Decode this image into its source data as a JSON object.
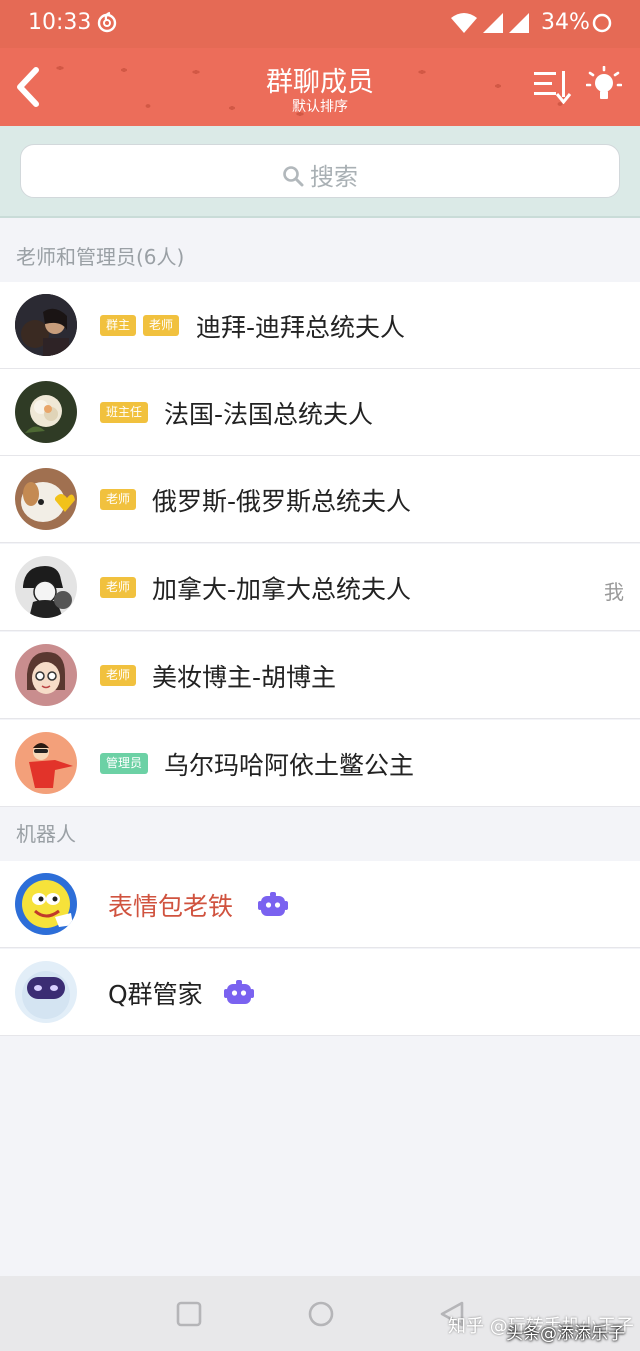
{
  "status_bar": {
    "time": "10:33",
    "battery": "34%",
    "icons": [
      "netease-music-icon",
      "wifi-icon",
      "signal-icon",
      "signal-icon",
      "battery-ring-icon"
    ]
  },
  "header": {
    "title": "群聊成员",
    "subtitle": "默认排序",
    "back_icon": "chevron-left-icon",
    "sort_icon": "sort-list-icon",
    "bulb_icon": "lightbulb-icon",
    "background": "#ec6d5a"
  },
  "search": {
    "placeholder": "搜索",
    "icon": "search-icon"
  },
  "sections": {
    "admins": {
      "header": "老师和管理员(6人)",
      "members": [
        {
          "badges": [
            "群主",
            "老师"
          ],
          "name": "迪拜-迪拜总统夫人"
        },
        {
          "badges": [
            "班主任"
          ],
          "name": "法国-法国总统夫人"
        },
        {
          "badges": [
            "老师"
          ],
          "name": "俄罗斯-俄罗斯总统夫人"
        },
        {
          "badges": [
            "老师"
          ],
          "name": "加拿大-加拿大总统夫人",
          "tag": "我"
        },
        {
          "badges": [
            "老师"
          ],
          "name": "美妆博主-胡博主"
        },
        {
          "badges": [
            "管理员"
          ],
          "name": "乌尔玛哈阿依土鳖公主"
        }
      ]
    },
    "robots": {
      "header": "机器人",
      "members": [
        {
          "name": "表情包老铁",
          "name_color": "#d0533f",
          "icon": "robot-icon"
        },
        {
          "name": "Q群管家",
          "icon": "robot-icon"
        }
      ]
    }
  },
  "colors": {
    "badge_gold": "#f1c13e",
    "badge_green": "#6cd1a5",
    "robot_purple": "#7a62f0"
  },
  "watermark": {
    "zhihu": "知乎 @玩转手机小王子",
    "toutiao": "头条@添添乐子"
  }
}
